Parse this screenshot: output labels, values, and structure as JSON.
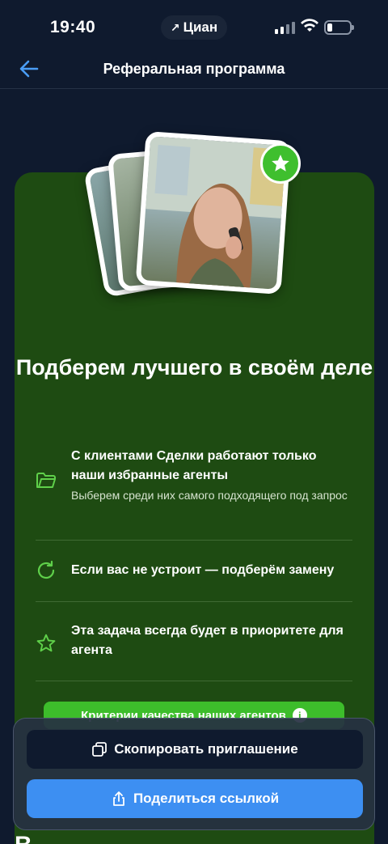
{
  "status_bar": {
    "time": "19:40",
    "app_name": "Циан"
  },
  "header": {
    "title": "Реферальная программа",
    "back_icon": "arrow-left-icon"
  },
  "hero": {
    "headline": "Подберем лучшего в своём деле",
    "badge_icon": "star-icon"
  },
  "features": [
    {
      "icon": "folder-icon",
      "title": "С клиентами Сделки работают только наши избранные агенты",
      "subtitle": "Выберем среди них самого подходящего под запрос"
    },
    {
      "icon": "refresh-icon",
      "title": "Если вас не устроит — подберём замену"
    },
    {
      "icon": "star-outline-icon",
      "title": "Эта задача всегда будет в приоритете для агента"
    }
  ],
  "criteria_button": {
    "label": "Критерии качества наших агентов",
    "icon": "info-icon",
    "icon_glyph": "i"
  },
  "actions": {
    "copy_label": "Скопировать приглашение",
    "copy_icon": "copy-icon",
    "share_label": "Поделиться ссылкой",
    "share_icon": "share-icon"
  },
  "bottom_peek": "В",
  "colors": {
    "background": "#0f1a2e",
    "card_green": "#1e4b12",
    "accent_green": "#3dbd2b",
    "share_blue": "#3d8ff2",
    "back_arrow": "#4a9df5"
  }
}
